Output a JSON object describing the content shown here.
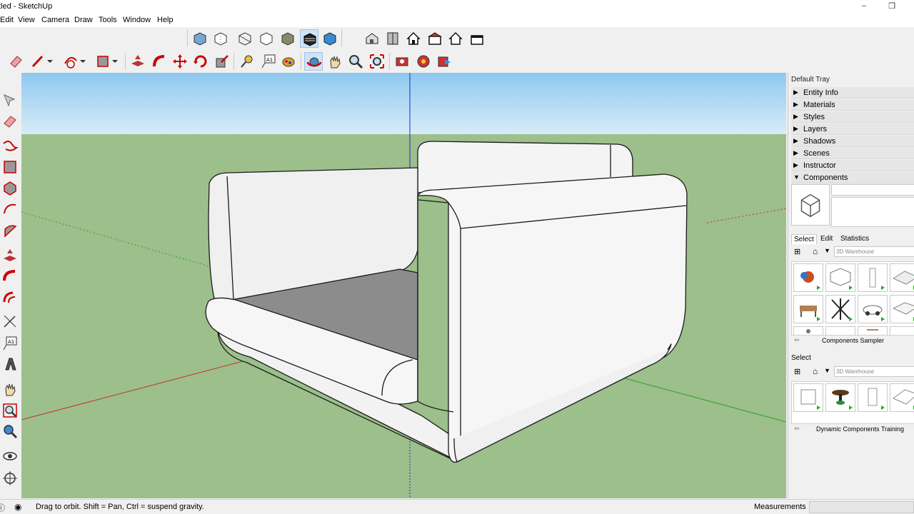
{
  "window": {
    "title": "tled - SketchUp",
    "minimize": "–",
    "restore": "❐"
  },
  "menu": [
    "Edit",
    "View",
    "Camera",
    "Draw",
    "Tools",
    "Window",
    "Help"
  ],
  "tray": {
    "title": "Default Tray",
    "panels": [
      {
        "label": "Entity Info",
        "expanded": false
      },
      {
        "label": "Materials",
        "expanded": false
      },
      {
        "label": "Styles",
        "expanded": false
      },
      {
        "label": "Layers",
        "expanded": false
      },
      {
        "label": "Shadows",
        "expanded": false
      },
      {
        "label": "Scenes",
        "expanded": false
      },
      {
        "label": "Instructor",
        "expanded": false
      },
      {
        "label": "Components",
        "expanded": true
      }
    ],
    "tabs": [
      "Select",
      "Edit",
      "Statistics"
    ],
    "search_placeholder_1": "3D Warehouse",
    "collection_1": "Components Sampler",
    "select_label_2": "Select",
    "search_placeholder_2": "3D Warehouse",
    "collection_2": "Dynamic Components Training"
  },
  "status": {
    "hint": "Drag to orbit. Shift = Pan, Ctrl = suspend gravity.",
    "measurements_label": "Measurements",
    "measurements_value": ""
  },
  "colors": {
    "sky": "#9ecff0",
    "ground": "#9cbf8b",
    "sofa": "#f3f3f3",
    "seat": "#8c8c8c",
    "blue_axis": "#1c2cc8",
    "red_axis": "#c83028",
    "green_axis": "#30a030"
  }
}
